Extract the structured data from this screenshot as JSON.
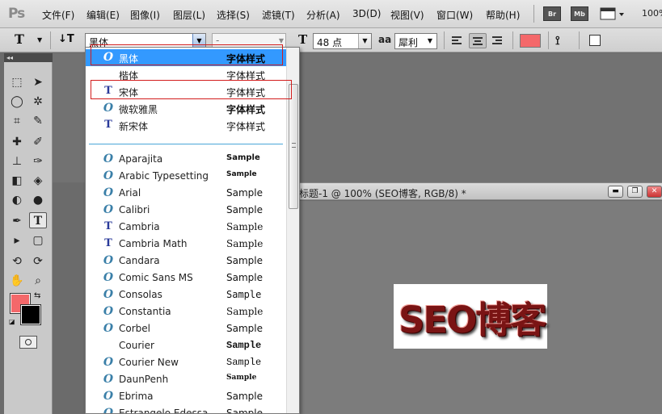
{
  "app": {
    "logo": "Ps",
    "zoom": "100%"
  },
  "menu": [
    "文件(F)",
    "编辑(E)",
    "图像(I)",
    "图层(L)",
    "选择(S)",
    "滤镜(T)",
    "分析(A)",
    "3D(D)",
    "视图(V)",
    "窗口(W)",
    "帮助(H)"
  ],
  "app_buttons": {
    "bridge": "Br",
    "mini_bridge": "Mb"
  },
  "options": {
    "font_family": "黑体",
    "font_style": "-",
    "font_size": "48 点",
    "antialias_icon": "aa",
    "antialias": "犀利",
    "text_color": "#f4686a"
  },
  "document": {
    "title": "标题-1 @ 100% (SEO博客, RGB/8) *",
    "canvas_text": "SEO博客"
  },
  "font_list": {
    "cjk": [
      {
        "icon": "opentype-icon",
        "name": "黑体",
        "sample": "字体样式",
        "selected": true
      },
      {
        "icon": "none",
        "name": "楷体",
        "sample": "字体样式"
      },
      {
        "icon": "truetype-icon",
        "name": "宋体",
        "sample": "字体样式"
      },
      {
        "icon": "opentype-icon",
        "name": "微软雅黑",
        "sample": "字体样式"
      },
      {
        "icon": "truetype-icon",
        "name": "新宋体",
        "sample": "字体样式"
      }
    ],
    "latin": [
      {
        "icon": "opentype-icon",
        "name": "Aparajita",
        "sample": "Sample"
      },
      {
        "icon": "opentype-icon",
        "name": "Arabic Typesetting",
        "sample": "Sample"
      },
      {
        "icon": "opentype-icon",
        "name": "Arial",
        "sample": "Sample"
      },
      {
        "icon": "opentype-icon",
        "name": "Calibri",
        "sample": "Sample"
      },
      {
        "icon": "truetype-icon",
        "name": "Cambria",
        "sample": "Sample"
      },
      {
        "icon": "truetype-icon",
        "name": "Cambria Math",
        "sample": "Sample"
      },
      {
        "icon": "opentype-icon",
        "name": "Candara",
        "sample": "Sample"
      },
      {
        "icon": "opentype-icon",
        "name": "Comic Sans MS",
        "sample": "Sample"
      },
      {
        "icon": "opentype-icon",
        "name": "Consolas",
        "sample": "Sample"
      },
      {
        "icon": "opentype-icon",
        "name": "Constantia",
        "sample": "Sample"
      },
      {
        "icon": "opentype-icon",
        "name": "Corbel",
        "sample": "Sample"
      },
      {
        "icon": "none",
        "name": "Courier",
        "sample": "Sample"
      },
      {
        "icon": "opentype-icon",
        "name": "Courier New",
        "sample": "Sample"
      },
      {
        "icon": "opentype-icon",
        "name": "DaunPenh",
        "sample": "Sample"
      },
      {
        "icon": "opentype-icon",
        "name": "Ebrima",
        "sample": "Sample"
      },
      {
        "icon": "opentype-icon",
        "name": "Estrangelo Edessa",
        "sample": "Sample"
      }
    ]
  },
  "colors": {
    "foreground": "#f4686a",
    "background": "#000000",
    "selection": "#3399ff",
    "annotation": "#d21c1c"
  }
}
